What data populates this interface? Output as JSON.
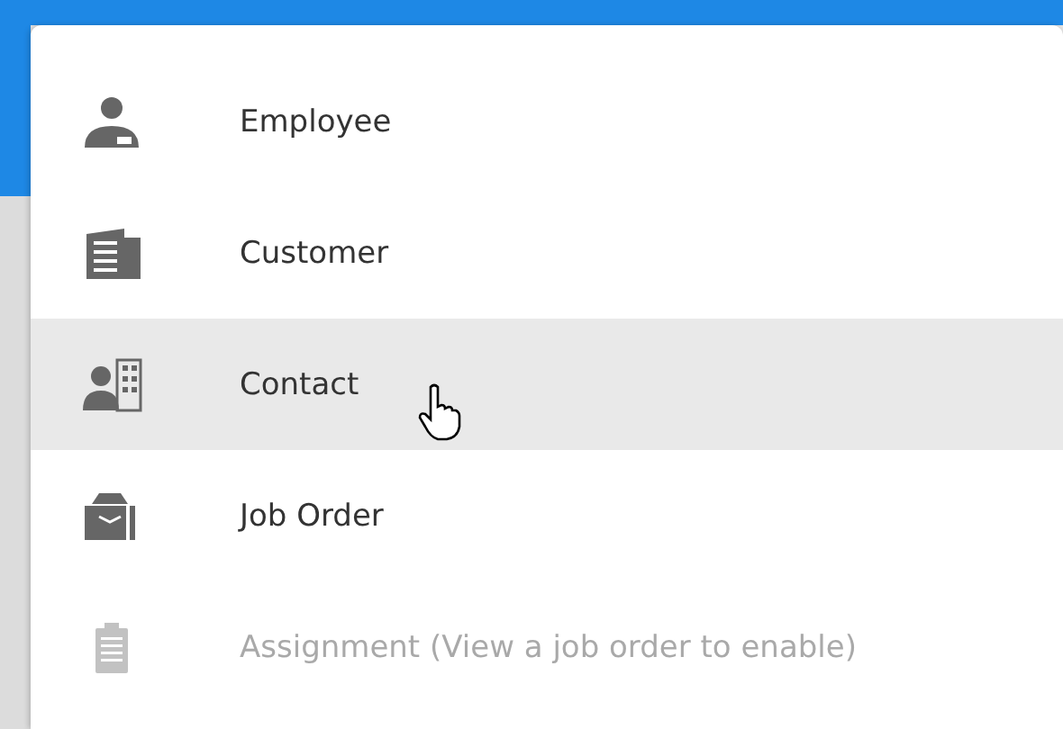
{
  "menu_items": [
    {
      "label": "Employee",
      "kind": "employee",
      "selected": false,
      "disabled": false
    },
    {
      "label": "Customer",
      "kind": "customer",
      "selected": false,
      "disabled": false
    },
    {
      "label": "Contact",
      "kind": "contact",
      "selected": true,
      "disabled": false
    },
    {
      "label": "Job Order",
      "kind": "job-order",
      "selected": false,
      "disabled": false
    },
    {
      "label": "Assignment (View a job order to enable)",
      "kind": "assignment",
      "selected": false,
      "disabled": true
    }
  ]
}
